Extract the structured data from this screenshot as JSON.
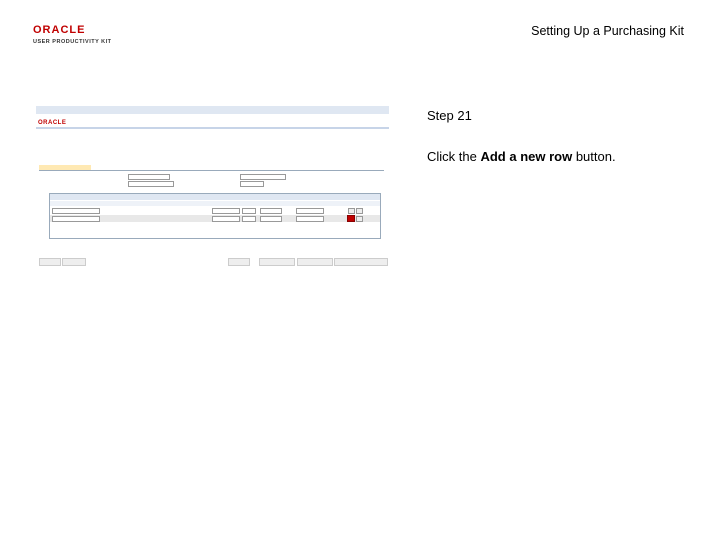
{
  "logo": {
    "wordmark": "ORACLE",
    "subtitle": "USER PRODUCTIVITY KIT"
  },
  "header": {
    "title": "Setting Up a Purchasing Kit"
  },
  "step": {
    "label": "Step 21",
    "instruction_prefix": "Click the ",
    "instruction_bold": "Add a new row",
    "instruction_suffix": " button."
  }
}
